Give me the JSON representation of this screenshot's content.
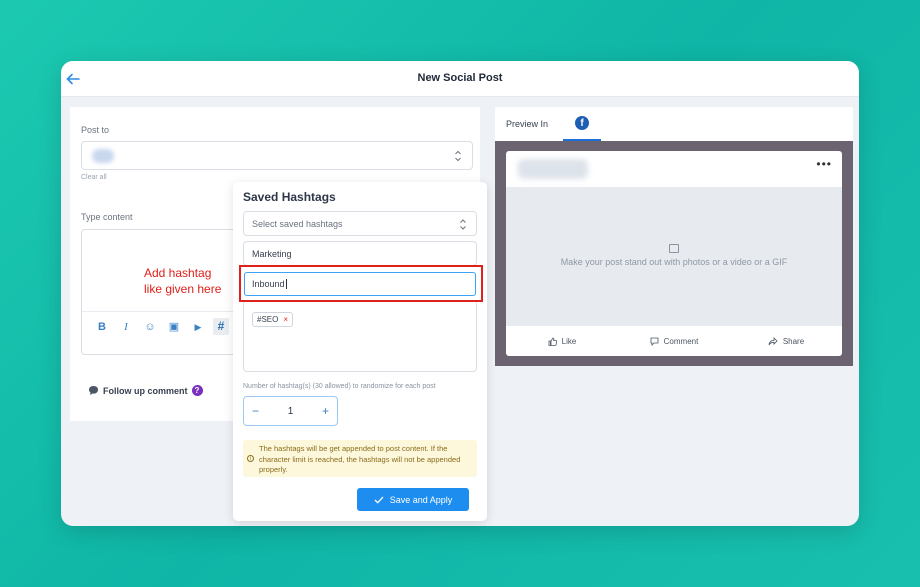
{
  "header": {
    "title": "New Social Post"
  },
  "left": {
    "post_to_label": "Post to",
    "clear_all": "Clear all",
    "type_content_label": "Type content",
    "annotation_line1": "Add hashtag",
    "annotation_line2": "like given here",
    "tools": [
      "B",
      "I",
      "☺",
      "▣",
      "▶",
      "#"
    ],
    "follow_up": "Follow up comment",
    "follow_help": "?"
  },
  "preview": {
    "label": "Preview In",
    "fb_icon": "f",
    "media_hint": "Make your post stand out with photos or a video or a GIF",
    "more": "•••",
    "actions": {
      "like": "Like",
      "comment": "Comment",
      "share": "Share"
    }
  },
  "hashtags": {
    "title": "Saved Hashtags",
    "select_placeholder": "Select saved hashtags",
    "name_value": "Marketing",
    "active_value": "Inbound",
    "tag": "#SEO",
    "tag_remove": "×",
    "count_label": "Number of hashtag(s) (30 allowed) to randomize for each post",
    "stepper": {
      "minus": "−",
      "value": "1",
      "plus": "+"
    },
    "notice": "The hashtags will be get appended to post content. If the character limit is reached, the hashtags will not be appended properly.",
    "save_label": "Save and Apply"
  },
  "colors": {
    "accent": "#1e8df0",
    "annotation": "#e0201b",
    "facebook": "#1e5fb3"
  }
}
